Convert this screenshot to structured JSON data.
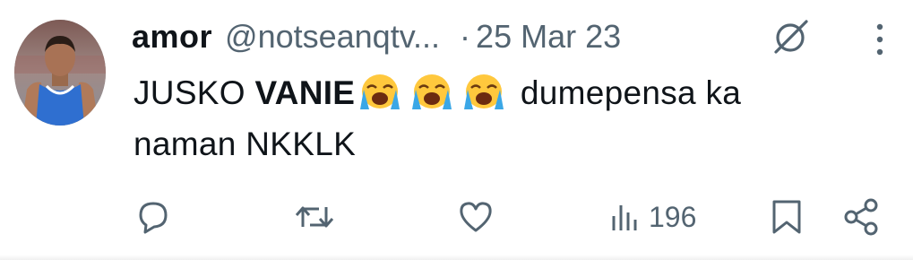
{
  "tweet": {
    "author": {
      "display_name": "amor",
      "handle": "@notseanqtv...",
      "avatar": "avatar-image"
    },
    "separator": "·",
    "date": "25 Mar 23",
    "text": {
      "prefix": "JUSKO ",
      "bold": "VANIE",
      "emoji": [
        "loudly-crying-face",
        "loudly-crying-face",
        "loudly-crying-face"
      ],
      "suffix": " dumepensa ka naman NKKLK"
    },
    "actions": {
      "reply": "reply-icon",
      "retweet": "retweet-icon",
      "like": "heart-icon",
      "views_count": "196",
      "bookmark": "bookmark-icon",
      "share": "share-icon"
    },
    "icons": {
      "grok": "grok-icon",
      "more": "more-icon"
    },
    "colors": {
      "text_primary": "#0f1419",
      "text_secondary": "#536471"
    }
  }
}
